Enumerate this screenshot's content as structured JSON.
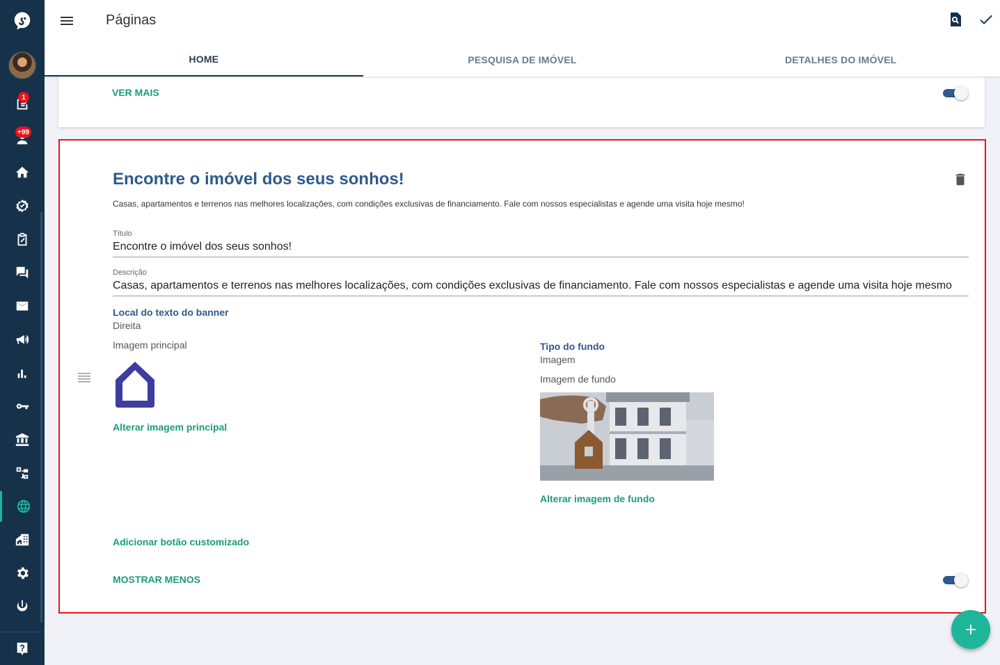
{
  "sidebar": {
    "badges": {
      "tasks": "1",
      "notifications": "+99"
    },
    "help_icon": "help-icon"
  },
  "topbar": {
    "title": "Páginas"
  },
  "tabs": [
    {
      "label": "HOME",
      "active": true
    },
    {
      "label": "PESQUISA DE IMÓVEL",
      "active": false
    },
    {
      "label": "DETALHES DO IMÓVEL",
      "active": false
    }
  ],
  "prev_card": {
    "ver_mais_label": "VER MAIS"
  },
  "banner": {
    "title": "Encontre o imóvel dos seus sonhos!",
    "description": "Casas, apartamentos e terrenos nas melhores localizações, com condições exclusivas de financiamento. Fale com nossos especialistas e agende uma visita hoje mesmo!",
    "fields": {
      "titulo_label": "Título",
      "titulo_value": "Encontre o imóvel dos seus sonhos!",
      "descricao_label": "Descrição",
      "descricao_value": "Casas, apartamentos e terrenos nas melhores localizações, com condições exclusivas de financiamento. Fale com nossos especialistas e agende uma visita hoje mesmo"
    },
    "local_label": "Local do texto do banner",
    "local_value": "Direita",
    "imagem_principal_label": "Imagem principal",
    "alterar_imagem_principal": "Alterar imagem principal",
    "tipo_fundo_label": "Tipo do fundo",
    "tipo_fundo_value": "Imagem",
    "imagem_fundo_label": "Imagem de fundo",
    "alterar_imagem_fundo": "Alterar imagem de fundo",
    "adicionar_botao": "Adicionar botão customizado",
    "mostrar_menos": "MOSTRAR MENOS"
  },
  "colors": {
    "sidebar_bg": "#16324a",
    "accent_green": "#1fb59a",
    "title_blue": "#2e5a8c",
    "highlight_red": "#e8141b"
  }
}
